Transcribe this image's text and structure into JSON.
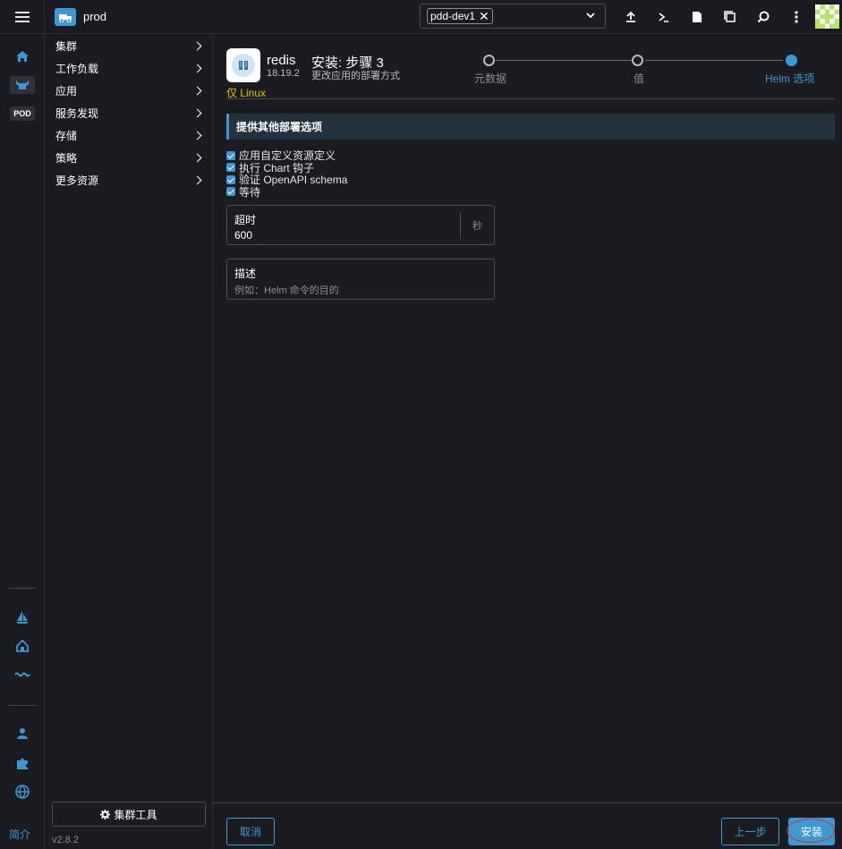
{
  "header": {
    "cluster_name": "prod",
    "namespace_chip": "pdd-dev1",
    "icons": [
      "import-yaml-icon",
      "kubectl-shell-icon",
      "kubeconfig-icon",
      "copy-kubeconfig-icon",
      "search-icon",
      "more-icon"
    ]
  },
  "rail": {
    "pod_badge": "POD",
    "bottom_text": "简介"
  },
  "sidenav": {
    "items": [
      {
        "label": "集群"
      },
      {
        "label": "工作负载"
      },
      {
        "label": "应用"
      },
      {
        "label": "服务发现"
      },
      {
        "label": "存储"
      },
      {
        "label": "策略"
      },
      {
        "label": "更多资源"
      }
    ],
    "tools_label": "集群工具",
    "version": "v2.8.2"
  },
  "chart": {
    "name": "redis",
    "version": "18.19.2",
    "linux_only": "仅 Linux"
  },
  "wizard": {
    "title": "安装: 步骤 3",
    "subtitle": "更改应用的部署方式",
    "steps": [
      {
        "label": "元数据",
        "active": false
      },
      {
        "label": "值",
        "active": false
      },
      {
        "label": "Helm 选项",
        "active": true
      }
    ]
  },
  "options": {
    "section_title": "提供其他部署选项",
    "checkboxes": [
      {
        "label": "应用自定义资源定义",
        "checked": true
      },
      {
        "label": "执行 Chart 钩子",
        "checked": true
      },
      {
        "label": "验证 OpenAPI schema",
        "checked": true
      },
      {
        "label": "等待",
        "checked": true
      }
    ],
    "timeout": {
      "label": "超时",
      "value": "600",
      "suffix": "秒"
    },
    "description": {
      "label": "描述",
      "placeholder": "例如：Helm 命令的目的"
    }
  },
  "footer": {
    "cancel": "取消",
    "previous": "上一步",
    "install": "安装"
  },
  "colors": {
    "accent": "#3d98d3",
    "background": "#1b1c21",
    "linux_badge": "#e6c100",
    "highlight_ring": "#d0312d"
  }
}
